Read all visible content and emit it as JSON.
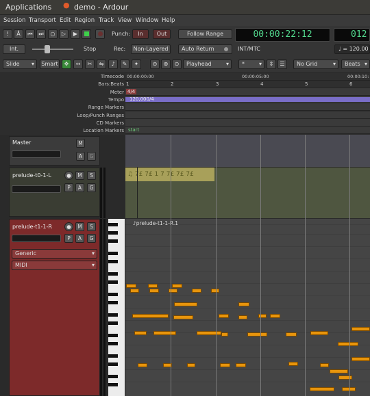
{
  "topbar": {
    "apps": "Applications",
    "title": "demo - Ardour"
  },
  "menu": [
    "Session",
    "Transport",
    "Edit",
    "Region",
    "Track",
    "View",
    "Window",
    "Help"
  ],
  "transport": {
    "punch_label": "Punch:",
    "in_label": "In",
    "out_label": "Out",
    "follow_range": "Follow Range",
    "auto_return": "Auto Return",
    "rec_label": "Rec:",
    "non_layered": "Non-Layered",
    "int_label": "Int.",
    "stop_label": "Stop",
    "clock_primary": "00:00:22:12",
    "clock_secondary": "012",
    "int_mtc": "INT/MTC",
    "tempo_readout": "♩ = 120.00"
  },
  "edit_toolbar": {
    "mode": "Slide",
    "smart": "Smart",
    "playhead": "Playhead",
    "snap": "*",
    "grid": "No Grid",
    "beats": "Beats"
  },
  "rulers": {
    "labels": [
      "Timecode",
      "Bars:Beats",
      "Meter",
      "Tempo",
      "Range Markers",
      "Loop/Punch Ranges",
      "CD Markers",
      "Location Markers"
    ],
    "timecode_ticks": [
      "00:00:00:00",
      "00:00:05:00",
      "00:00:10:"
    ],
    "bar_ticks": [
      "1",
      "2",
      "3",
      "4",
      "5",
      "6"
    ],
    "meter_value": "4/4",
    "tempo_value": "120,000/4",
    "location_start": "start"
  },
  "tracks": [
    {
      "name": "Master",
      "buttons": [
        "M",
        "A",
        "G"
      ]
    },
    {
      "name": "prelude-t0-1-L",
      "buttons": [
        "M",
        "S",
        "P",
        "A",
        "G"
      ]
    },
    {
      "name": "prelude-t1-1-R",
      "buttons": [
        "M",
        "S",
        "P",
        "A",
        "G"
      ],
      "plugin": "Generic",
      "input": "MIDI",
      "region_name": "♪prelude-t1-1-R.1"
    }
  ],
  "colors": {
    "track_selected": "#7d2a2a",
    "note": "#e8950c",
    "clock": "#53d98e",
    "tempo_bar": "#7a6ec8"
  }
}
